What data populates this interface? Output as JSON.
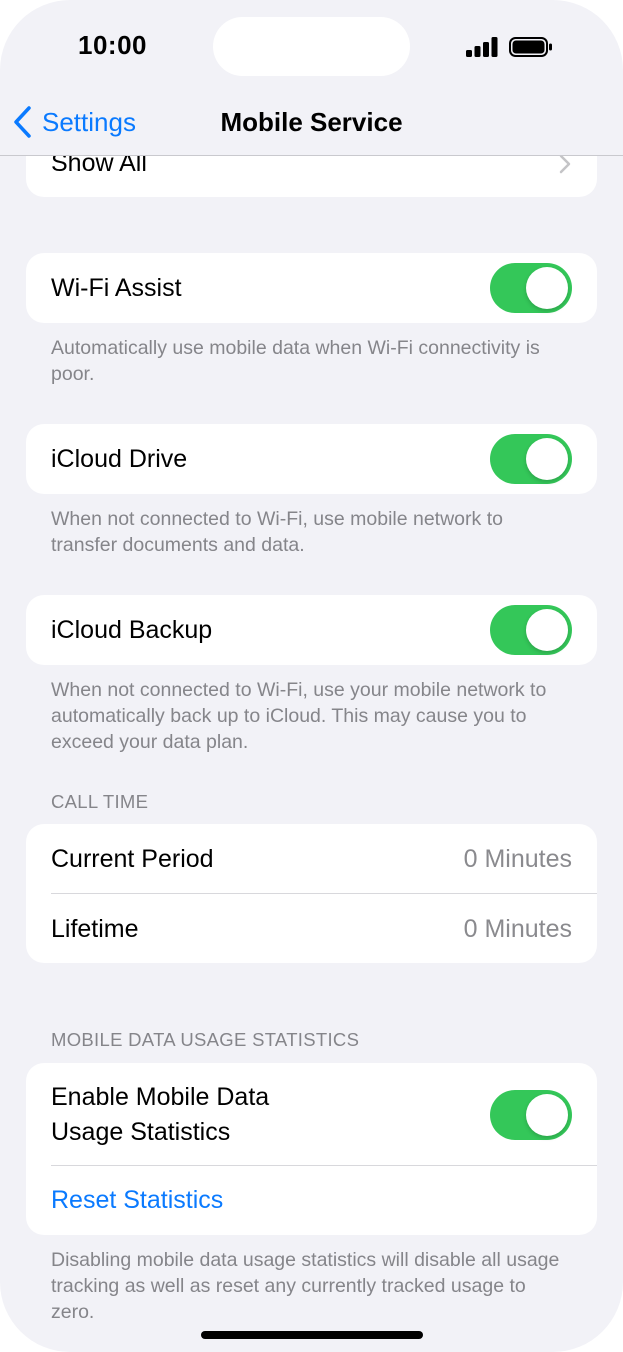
{
  "status_bar": {
    "time": "10:00"
  },
  "nav": {
    "back_label": "Settings",
    "title": "Mobile Service"
  },
  "show_all": {
    "label": "Show All"
  },
  "wifi_assist": {
    "label": "Wi-Fi Assist",
    "on": true,
    "footnote": "Automatically use mobile data when Wi-Fi connectivity is poor."
  },
  "icloud_drive": {
    "label": "iCloud Drive",
    "on": true,
    "footnote": "When not connected to Wi-Fi, use mobile network to transfer documents and data."
  },
  "icloud_backup": {
    "label": "iCloud Backup",
    "on": true,
    "footnote": "When not connected to Wi-Fi, use your mobile network to automatically back up to iCloud. This may cause you to exceed your data plan."
  },
  "call_time": {
    "header": "CALL TIME",
    "rows": [
      {
        "label": "Current Period",
        "value": "0 Minutes"
      },
      {
        "label": "Lifetime",
        "value": "0 Minutes"
      }
    ]
  },
  "usage_stats": {
    "header": "MOBILE DATA USAGE STATISTICS",
    "enable_label_line1": "Enable Mobile Data",
    "enable_label_line2": "Usage Statistics",
    "on": true,
    "reset_label": "Reset Statistics",
    "footnote": "Disabling mobile data usage statistics will disable all usage tracking as well as reset any currently tracked usage to zero."
  },
  "colors": {
    "accent": "#0a7aff",
    "toggle_on": "#34c759",
    "background": "#f2f2f7"
  }
}
